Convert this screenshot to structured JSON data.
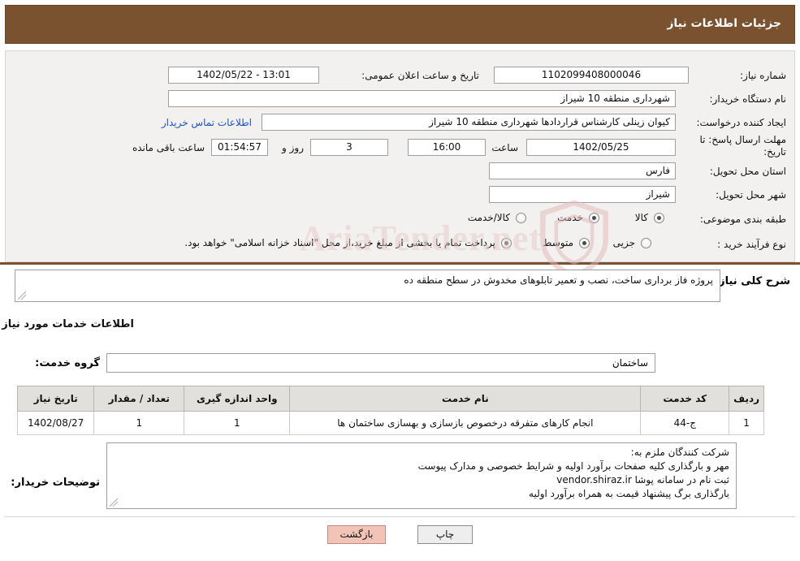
{
  "header": {
    "title": "جزئیات اطلاعات نیاز"
  },
  "info": {
    "need_number_label": "شماره نیاز:",
    "need_number_value": "1102099408000046",
    "announce_datetime_label": "تاریخ و ساعت اعلان عمومی:",
    "announce_datetime_value": "13:01 - 1402/05/22",
    "buyer_org_label": "نام دستگاه خریدار:",
    "buyer_org_value": "شهرداری منطقه 10 شیراز",
    "creator_label": "ایجاد کننده درخواست:",
    "creator_value": "کیوان زینلی کارشناس قراردادها شهرداری منطقه 10 شیراز",
    "contact_link": "اطلاعات تماس خریدار",
    "deadline_label": "مهلت ارسال پاسخ: تا تاریخ:",
    "deadline_date": "1402/05/25",
    "hour_label": "ساعت",
    "deadline_hour": "16:00",
    "days_value": "3",
    "days_text": "روز و",
    "remaining_time": "01:54:57",
    "remaining_text": "ساعت باقی مانده",
    "province_label": "استان محل تحویل:",
    "province_value": "فارس",
    "city_label": "شهر محل تحویل:",
    "city_value": "شیراز",
    "category_label": "طبقه بندی موضوعی:",
    "category_options": [
      "کالا",
      "خدمت",
      "کالا/خدمت"
    ],
    "category_selected": "خدمت",
    "process_label": "نوع فرآیند خرید :",
    "process_options": [
      "جزیی",
      "متوسط"
    ],
    "process_selected": "متوسط",
    "process_note": "پرداخت تمام یا بخشی از مبلغ خرید،از محل \"اسناد خزانه اسلامی\" خواهد بود."
  },
  "need_summary": {
    "label": "شرح کلی نیاز:",
    "value": "پروژه فاز برداری ساخت، نصب و تعمیر تابلوهای مخدوش در سطح منطقه ده"
  },
  "services": {
    "section_title": "اطلاعات خدمات مورد نیاز",
    "group_label": "گروه خدمت:",
    "group_value": "ساختمان",
    "columns": [
      "ردیف",
      "کد خدمت",
      "نام خدمت",
      "واحد اندازه گیری",
      "تعداد / مقدار",
      "تاریخ نیاز"
    ],
    "rows": [
      {
        "index": "1",
        "code": "ج-44",
        "name": "انجام کارهای متفرقه درخصوص بازسازی و بهسازی ساختمان ها",
        "unit": "1",
        "qty": "1",
        "date": "1402/08/27"
      }
    ]
  },
  "notes": {
    "label": "توضیحات خریدار:",
    "lines": [
      "شرکت کنندگان ملزم به:",
      "مهر و بارگذاری کلیه صفحات برآورد اولیه و شرایط خصوصی و مدارک پیوست",
      "ثبت نام در سامانه پوشا vendor.shiraz.ir",
      "بارگذاری برگ پیشنهاد قیمت به همراه برآورد اولیه"
    ]
  },
  "footer": {
    "print_label": "چاپ",
    "back_label": "بازگشت"
  },
  "watermark": {
    "text": "AriaTender.net",
    "icon": "shield-icon"
  },
  "colors": {
    "header_bg": "#7a5230",
    "panel_bg": "#f2f1ef",
    "link": "#1a54c8",
    "back_button": "#f2c4b8"
  }
}
